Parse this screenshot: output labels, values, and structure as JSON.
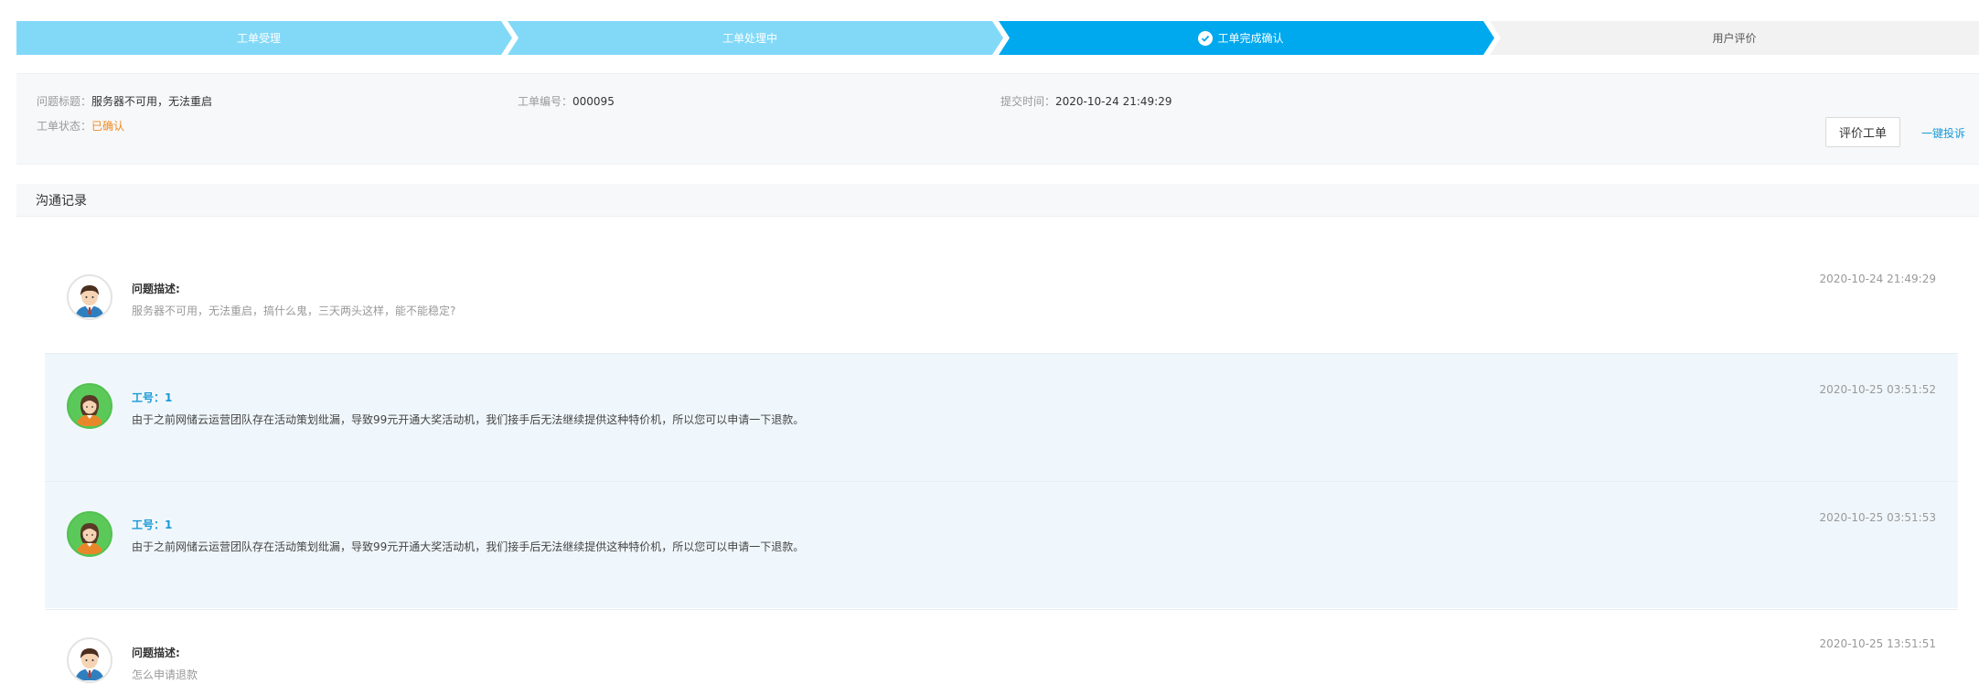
{
  "steps": [
    {
      "label": "工单受理",
      "bg": "#82d9f7"
    },
    {
      "label": "工单处理中",
      "bg": "#82d9f7"
    },
    {
      "label": "工单完成确认",
      "bg": "#00a8ee",
      "active": true
    },
    {
      "label": "用户评价",
      "bg": "#f2f2f2",
      "fg": "#555555"
    }
  ],
  "info": {
    "title_key": "问题标题：",
    "title_value": "服务器不可用，无法重启",
    "number_key": "工单编号：",
    "number_value": "000095",
    "time_key": "提交时间：",
    "time_value": "2020-10-24 21:49:29",
    "status_key": "工单状态：",
    "status_value": "已确认",
    "evaluate_label": "评价工单",
    "complain_label": "一键投诉"
  },
  "section": {
    "title": "沟通记录"
  },
  "records": [
    {
      "role": "user",
      "title": "问题描述:",
      "text": "服务器不可用，无法重启，搞什么鬼，三天两头这样，能不能稳定?",
      "time": "2020-10-24 21:49:29"
    },
    {
      "role": "agent",
      "title": "工号：1",
      "text": "由于之前网储云运营团队存在活动策划纰漏，导致99元开通大奖活动机，我们接手后无法继续提供这种特价机，所以您可以申请一下退款。",
      "time": "2020-10-25 03:51:52"
    },
    {
      "role": "agent",
      "title": "工号：1",
      "text": "由于之前网储云运营团队存在活动策划纰漏，导致99元开通大奖活动机，我们接手后无法继续提供这种特价机，所以您可以申请一下退款。",
      "time": "2020-10-25 03:51:53"
    },
    {
      "role": "user",
      "title": "问题描述:",
      "text": "怎么申请退款",
      "time": "2020-10-25 13:51:51"
    }
  ]
}
